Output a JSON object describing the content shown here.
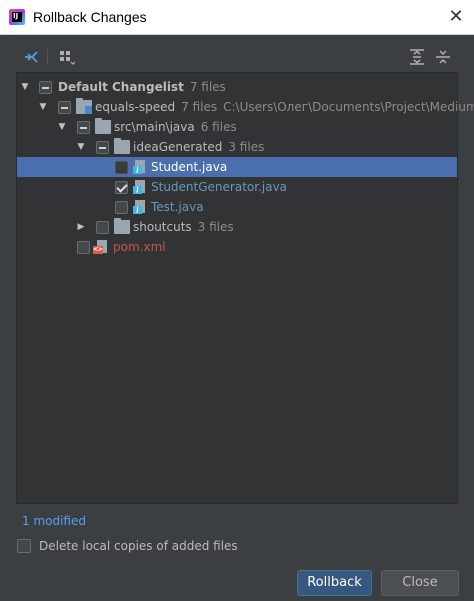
{
  "window": {
    "title": "Rollback Changes",
    "close_glyph": "✕"
  },
  "toolbar": {
    "group_by_icon": "group-by-icon",
    "layout_icon": "layout-icon",
    "expand_all_icon": "expand-all-icon",
    "collapse_all_icon": "collapse-all-icon"
  },
  "tree": {
    "changelist": {
      "name": "Default Changelist",
      "count": "7 files"
    },
    "module": {
      "name": "equals-speed",
      "count": "7 files",
      "path": "C:\\Users\\Олег\\Documents\\Project\\Medium"
    },
    "src_folder": {
      "name": "src\\main\\java",
      "count": "6 files"
    },
    "generated_folder": {
      "name": "ideaGenerated",
      "count": "3 files"
    },
    "files": [
      {
        "name": "Student.java",
        "checked": false,
        "selected": true
      },
      {
        "name": "StudentGenerator.java",
        "checked": true,
        "selected": false
      },
      {
        "name": "Test.java",
        "checked": false,
        "selected": false
      }
    ],
    "shoutcuts_folder": {
      "name": "shoutcuts",
      "count": "3 files"
    },
    "pom": {
      "name": "pom.xml"
    }
  },
  "footer": {
    "modified_text": "1 modified",
    "delete_label": "Delete local copies of added files",
    "rollback_label": "Rollback",
    "close_label": "Close"
  },
  "colors": {
    "background": "#3c3f41",
    "tree_background": "#313335",
    "selection": "#4b6eaf",
    "link": "#589df6",
    "primary_button": "#365880"
  }
}
